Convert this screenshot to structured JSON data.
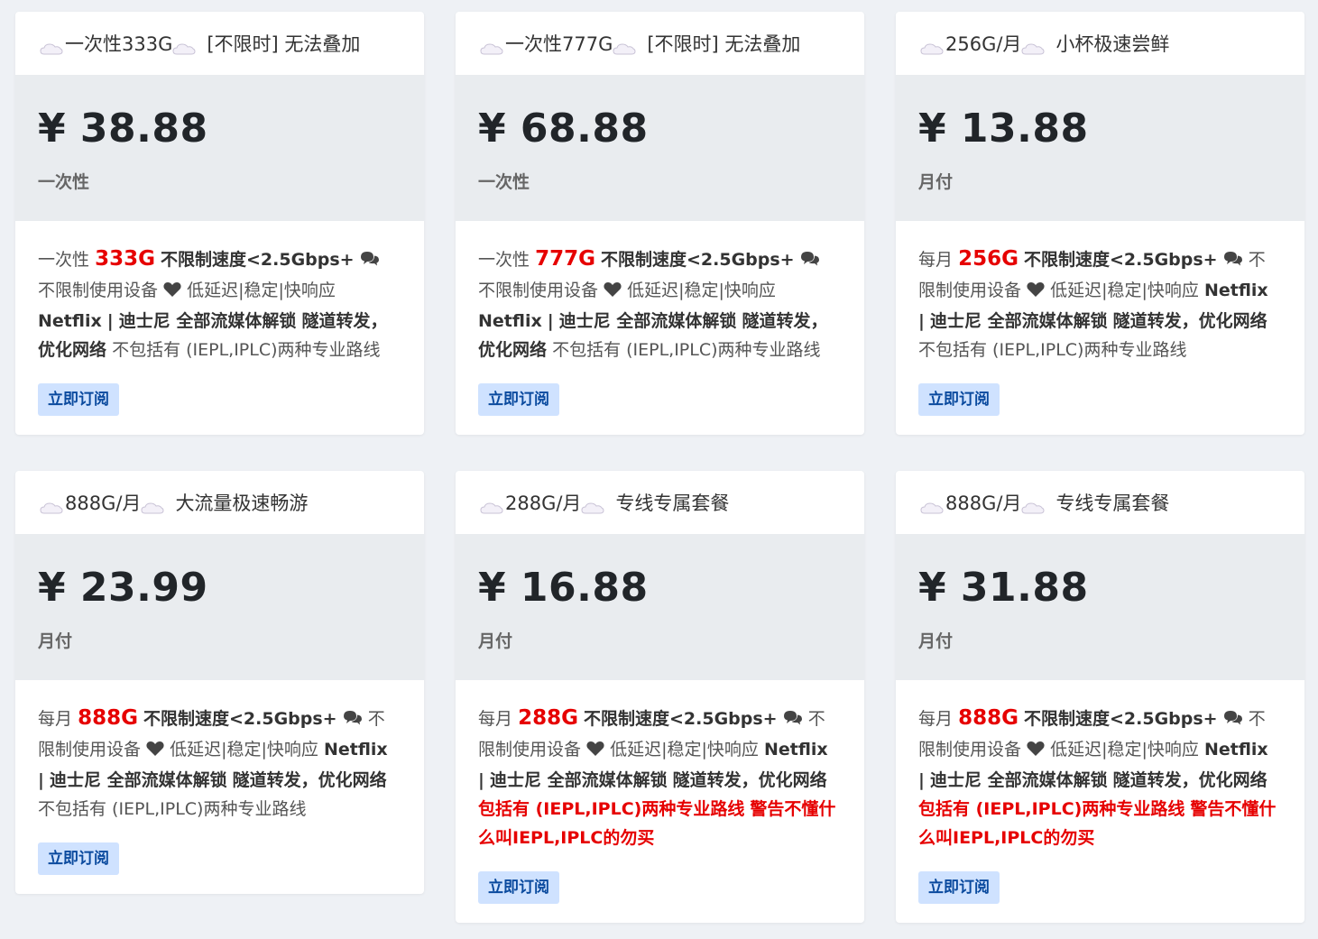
{
  "colors": {
    "accent_red": "#e60000",
    "button_bg": "#cfe2ff",
    "button_text": "#0a4a9e",
    "price_band_bg": "#e9ecef"
  },
  "common": {
    "unlimited_speed": "不限制速度<2.5Gbps+",
    "unlimited_devices": "不限制使用设备",
    "latency": "低延迟|稳定|快响应",
    "netflix": "Netflix",
    "disney": "迪士尼 全部流媒体解锁",
    "tunnel": "隧道转发，优化网络",
    "not_include": "不包括有 (IEPL,IPLC)两种专业路线",
    "include": "包括有 (IEPL,IPLC)两种专业路线",
    "warning": "警告不懂什么叫IEPL,IPLC的勿买",
    "button_label": "立即订阅"
  },
  "plans": [
    {
      "name": "一次性333G",
      "tag": "[不限时] 无法叠加",
      "price": "¥ 38.88",
      "cycle": "一次性",
      "quota_prefix": "一次性",
      "quota": "333G"
    },
    {
      "name": "一次性777G",
      "tag": "[不限时] 无法叠加",
      "price": "¥ 68.88",
      "cycle": "一次性",
      "quota_prefix": "一次性",
      "quota": "777G"
    },
    {
      "name": "256G/月",
      "tag": "小杯极速尝鲜",
      "price": "¥ 13.88",
      "cycle": "月付",
      "quota_prefix": "每月",
      "quota": "256G"
    },
    {
      "name": "888G/月",
      "tag": "大流量极速畅游",
      "price": "¥ 23.99",
      "cycle": "月付",
      "quota_prefix": "每月",
      "quota": "888G"
    },
    {
      "name": "288G/月",
      "tag": "专线专属套餐",
      "price": "¥ 16.88",
      "cycle": "月付",
      "quota_prefix": "每月",
      "quota": "288G"
    },
    {
      "name": "888G/月",
      "tag": "专线专属套餐",
      "price": "¥ 31.88",
      "cycle": "月付",
      "quota_prefix": "每月",
      "quota": "888G"
    }
  ]
}
